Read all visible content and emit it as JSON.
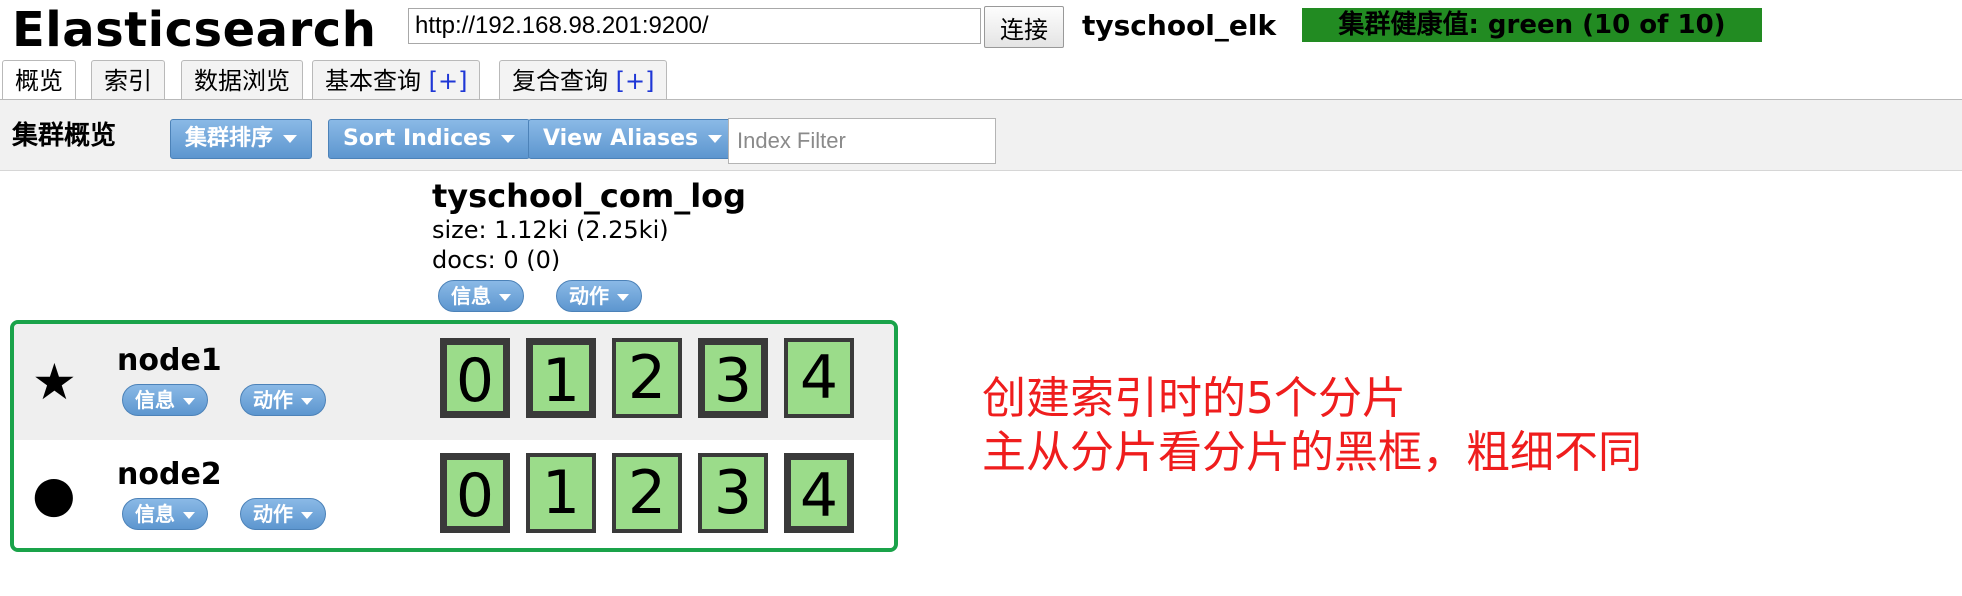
{
  "header": {
    "app_title": "Elasticsearch",
    "url_value": "http://192.168.98.201:9200/",
    "connect_label": "连接",
    "cluster_name": "tyschool_elk",
    "health_text": "集群健康值: green (10 of 10)",
    "health_color": "#228b22"
  },
  "tabs": [
    {
      "label": "概览",
      "plus": "",
      "active": true
    },
    {
      "label": "索引",
      "plus": ""
    },
    {
      "label": "数据浏览",
      "plus": ""
    },
    {
      "label": "基本查询",
      "plus": "[+]"
    },
    {
      "label": "复合查询",
      "plus": "[+]"
    }
  ],
  "toolbar": {
    "title": "集群概览",
    "sort_cluster_label": "集群排序",
    "sort_indices_label": "Sort Indices",
    "view_aliases_label": "View Aliases",
    "index_filter_placeholder": "Index Filter"
  },
  "index": {
    "name": "tyschool_com_log",
    "size": "size: 1.12ki (2.25ki)",
    "docs": "docs: 0 (0)",
    "info_label": "信息",
    "action_label": "动作"
  },
  "nodes": [
    {
      "name": "node1",
      "icon": "star-icon",
      "info_label": "信息",
      "action_label": "动作",
      "shards": [
        "0",
        "1",
        "2",
        "3",
        "4"
      ],
      "shard_kind": [
        "primary",
        "replica",
        "replica",
        "primary",
        "replica"
      ]
    },
    {
      "name": "node2",
      "icon": "circle-icon",
      "info_label": "信息",
      "action_label": "动作",
      "shards": [
        "0",
        "1",
        "2",
        "3",
        "4"
      ],
      "shard_kind": [
        "primary",
        "replica",
        "primary",
        "replica",
        "primary"
      ]
    }
  ],
  "annotation": {
    "line1": "创建索引时的5个分片",
    "line2": "主从分片看分片的黑框，粗细不同",
    "color": "#ef1d1d"
  },
  "colors": {
    "accent_blue": "#6fa6da",
    "shard_green": "#9bdc8a",
    "frame_green": "#1aa34a"
  }
}
